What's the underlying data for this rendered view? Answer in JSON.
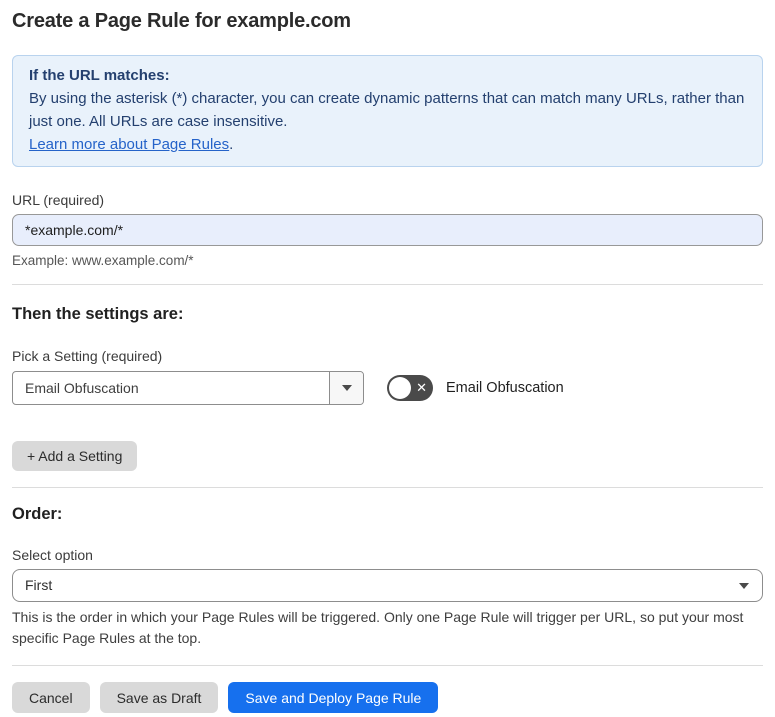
{
  "page": {
    "title": "Create a Page Rule for example.com"
  },
  "info_box": {
    "heading": "If the URL matches:",
    "body": "By using the asterisk (*) character, you can create dynamic patterns that can match many URLs, rather than just one. All URLs are case insensitive.",
    "link_label": "Learn more about Page Rules",
    "link_suffix": "."
  },
  "url_field": {
    "label": "URL (required)",
    "value": "*example.com/*",
    "helper": "Example: www.example.com/*"
  },
  "settings_section": {
    "heading": "Then the settings are:",
    "picker_label": "Pick a Setting (required)",
    "picker_value": "Email Obfuscation",
    "toggle_state": "off",
    "toggle_icon": "✕",
    "toggle_label": "Email Obfuscation",
    "add_button_label": "+ Add a Setting"
  },
  "order_section": {
    "heading": "Order:",
    "select_label": "Select option",
    "select_value": "First",
    "helper": "This is the order in which your Page Rules will be triggered. Only one Page Rule will trigger per URL, so put your most specific Page Rules at the top."
  },
  "footer": {
    "cancel_label": "Cancel",
    "save_draft_label": "Save as Draft",
    "deploy_label": "Save and Deploy Page Rule"
  },
  "colors": {
    "info_bg": "#e9f2fb",
    "info_border": "#b9d3ee",
    "info_text": "#24406f",
    "link": "#2563c9",
    "input_bg": "#e8eefc",
    "primary_button": "#1670ee",
    "gray_button": "#d9d9d9",
    "toggle_off": "#4a4a4a"
  }
}
